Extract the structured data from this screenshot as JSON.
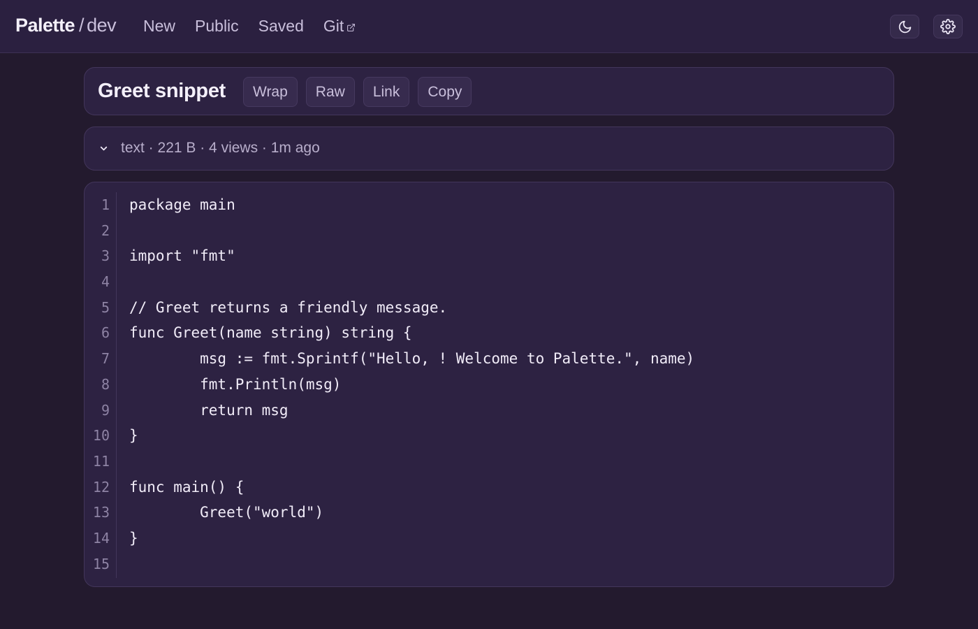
{
  "header": {
    "brand_name": "Palette",
    "brand_sep": "/",
    "brand_env": "dev",
    "nav": [
      "New",
      "Public",
      "Saved",
      "Git"
    ],
    "icons": [
      "moon-icon",
      "gear-icon",
      "external-link-icon"
    ]
  },
  "snippet": {
    "title": "Greet snippet",
    "actions": [
      "Wrap",
      "Raw",
      "Link",
      "Copy"
    ],
    "meta": "text · 221 B · 4 views · 1m ago"
  },
  "code": {
    "line_numbers": [
      "1",
      "2",
      "3",
      "4",
      "5",
      "6",
      "7",
      "8",
      "9",
      "10",
      "11",
      "12",
      "13",
      "14",
      "15"
    ],
    "lines": [
      "package main",
      "",
      "import \"fmt\"",
      "",
      "// Greet returns a friendly message.",
      "func Greet(name string) string {",
      "        msg := fmt.Sprintf(\"Hello, ! Welcome to Palette.\", name)",
      "        fmt.Println(msg)",
      "        return msg",
      "}",
      "",
      "func main() {",
      "        Greet(\"world\")",
      "}",
      ""
    ]
  },
  "colors": {
    "background": "#231a2e",
    "panel": "#2d2242",
    "topbar": "#2b2040",
    "text": "#ece6f5",
    "muted": "#c9bfdb"
  }
}
